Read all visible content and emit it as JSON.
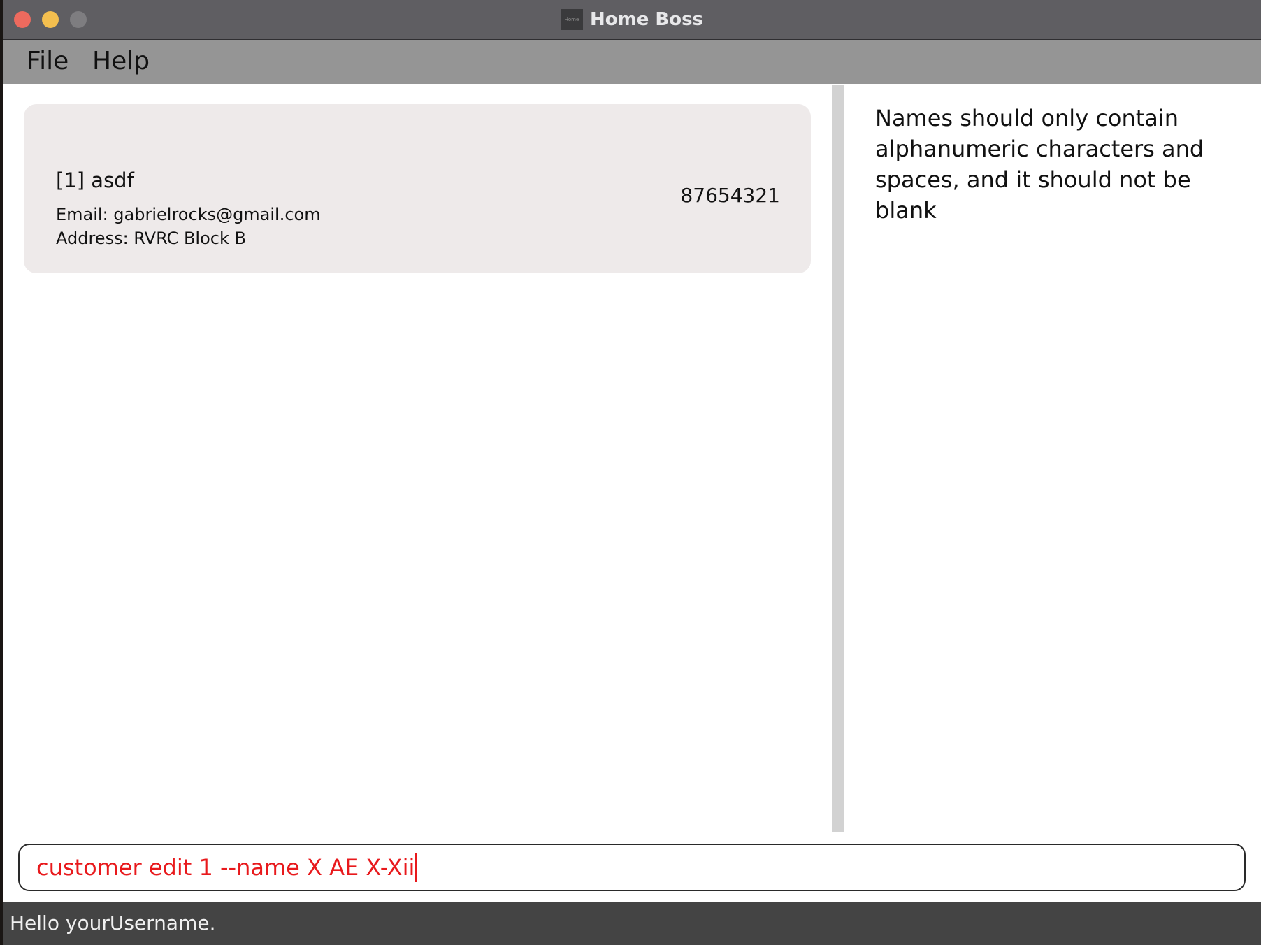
{
  "window": {
    "title": "Home Boss",
    "icon_label": "Home"
  },
  "menu": {
    "items": [
      "File",
      "Help"
    ]
  },
  "customers": [
    {
      "name": "[1] asdf",
      "email": "Email: gabrielrocks@gmail.com",
      "address": "Address: RVRC Block B",
      "phone": "87654321"
    }
  ],
  "result": {
    "message": "Names should only contain alphanumeric characters and spaces, and it should not be blank"
  },
  "command": {
    "value": "customer edit 1 --name X AE X-Xii",
    "color": "#e8191c"
  },
  "status": {
    "text": "Hello yourUsername."
  },
  "colors": {
    "titlebar": "#5f5e62",
    "menubar": "#959595",
    "card": "#eeeaea",
    "statusbar": "#444444",
    "error": "#e8191c"
  }
}
